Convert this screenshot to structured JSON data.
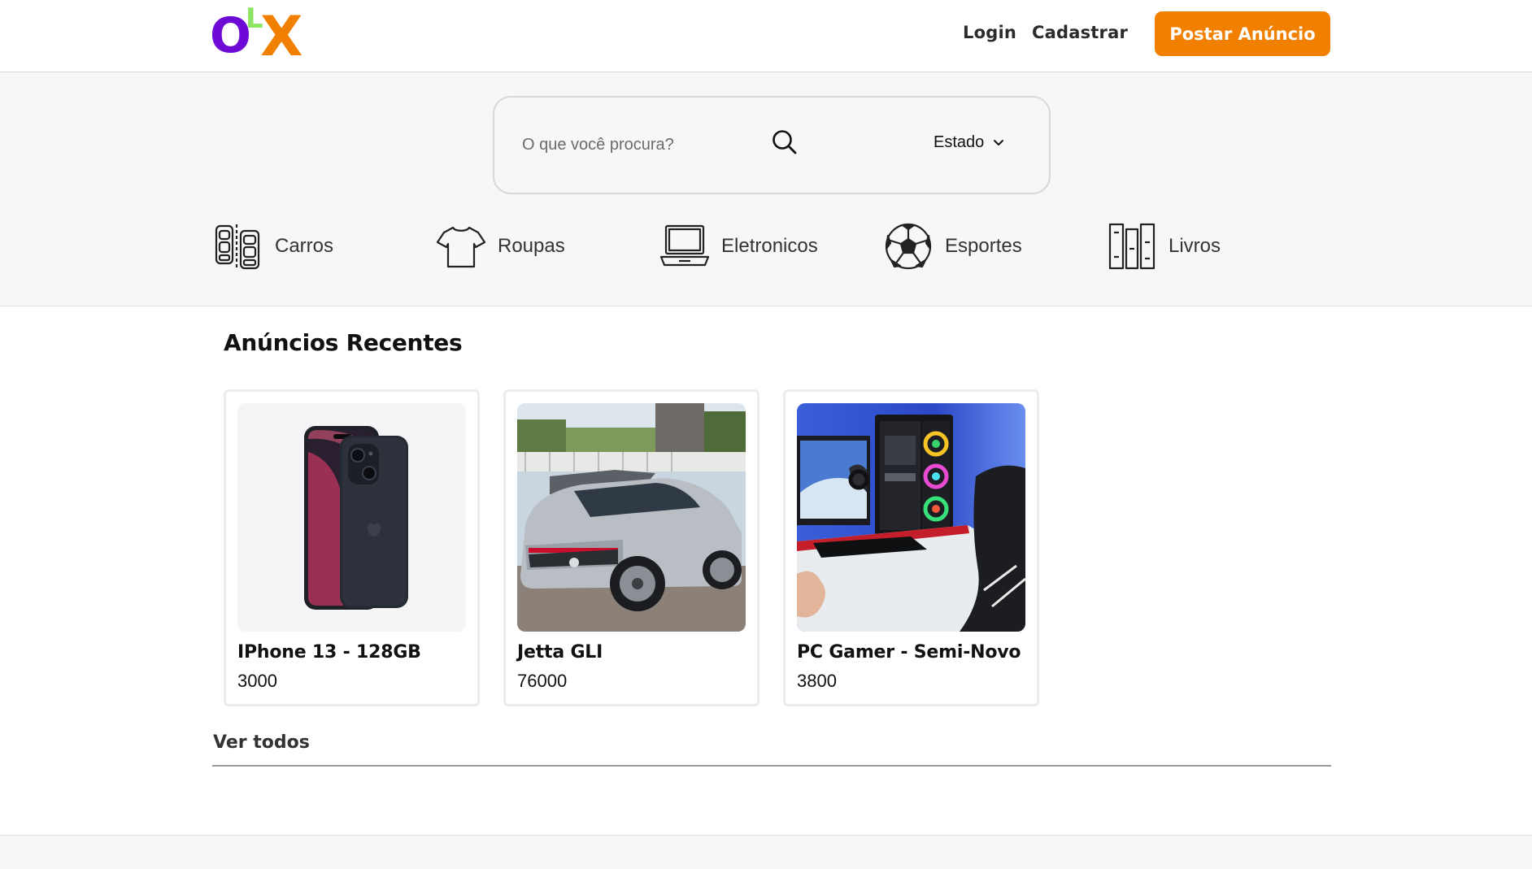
{
  "brand": {
    "logo_letters": [
      "O",
      "L",
      "X"
    ],
    "colors": {
      "o": "#6e0ad6",
      "l": "#8ce563",
      "x": "#f28000"
    }
  },
  "header": {
    "login_label": "Login",
    "signup_label": "Cadastrar",
    "post_button_label": "Postar Anúncio",
    "accent": "#f28000"
  },
  "search": {
    "placeholder": "O que você procura?",
    "state_label": "Estado"
  },
  "categories": [
    {
      "label": "Carros",
      "icon": "car-seats-icon"
    },
    {
      "label": "Roupas",
      "icon": "tshirt-icon"
    },
    {
      "label": "Eletronicos",
      "icon": "laptop-icon"
    },
    {
      "label": "Esportes",
      "icon": "soccer-ball-icon"
    },
    {
      "label": "Livros",
      "icon": "books-icon"
    }
  ],
  "recent": {
    "title": "Anúncios Recentes",
    "items": [
      {
        "title": "IPhone 13 - 128GB",
        "price": "3000"
      },
      {
        "title": "Jetta GLI",
        "price": "76000"
      },
      {
        "title": "PC Gamer - Semi-Novo",
        "price": "3800"
      }
    ],
    "see_all_label": "Ver todos"
  }
}
